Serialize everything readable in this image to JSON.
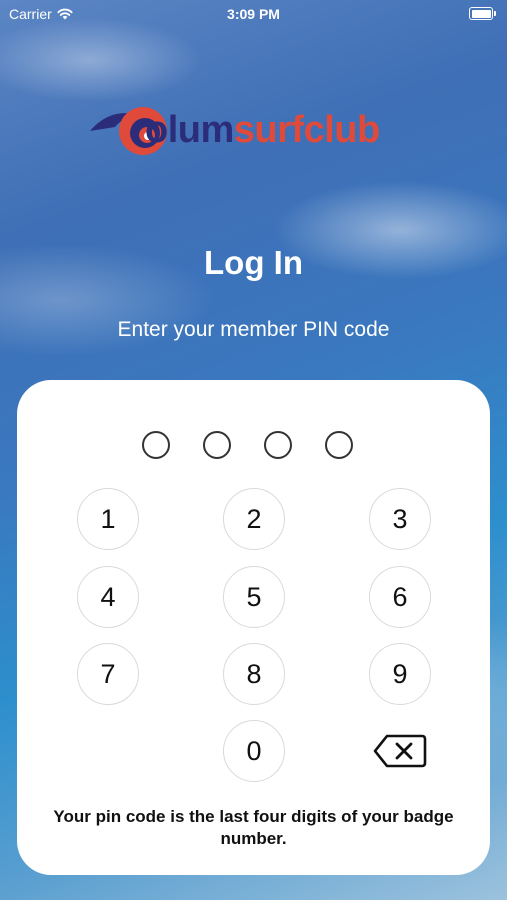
{
  "status_bar": {
    "carrier": "Carrier",
    "time": "3:09 PM"
  },
  "logo": {
    "text_part1": "olum",
    "text_part2": "surfclub"
  },
  "screen": {
    "title": "Log In",
    "subtitle": "Enter your member PIN code"
  },
  "pin": {
    "digits_entered": 0,
    "length": 4
  },
  "keypad": {
    "keys": [
      "1",
      "2",
      "3",
      "4",
      "5",
      "6",
      "7",
      "8",
      "9",
      "0"
    ],
    "backspace_icon": "backspace-icon"
  },
  "hint": "Your pin code is the last four digits of your badge number.",
  "colors": {
    "brand_navy": "#2b2d7a",
    "brand_red": "#e04a3a",
    "card": "#ffffff"
  }
}
